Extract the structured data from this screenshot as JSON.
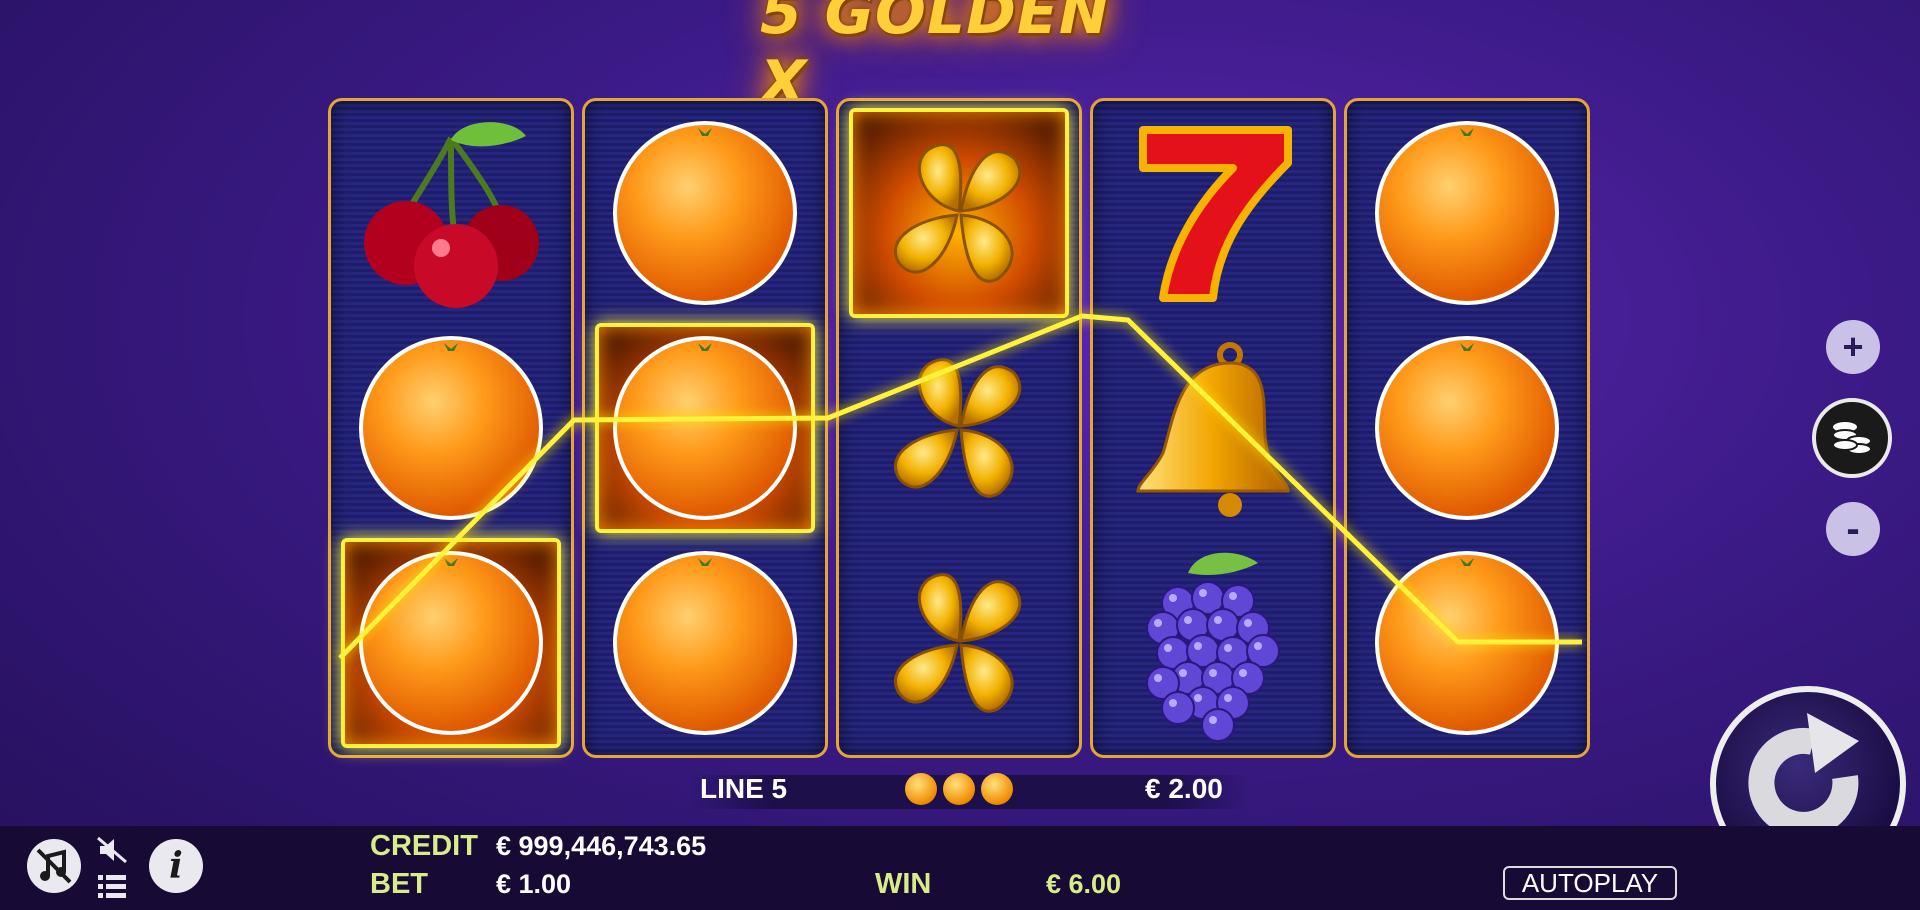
{
  "game": {
    "title": "5 GOLDEN X"
  },
  "reels": [
    {
      "symbols": [
        "cherry-icon",
        "orange-icon",
        "orange-icon"
      ],
      "highlighted": [
        false,
        false,
        true
      ]
    },
    {
      "symbols": [
        "orange-icon",
        "orange-icon",
        "orange-icon"
      ],
      "highlighted": [
        false,
        true,
        false
      ]
    },
    {
      "symbols": [
        "clover-icon",
        "clover-icon",
        "clover-icon"
      ],
      "highlighted": [
        true,
        false,
        false
      ]
    },
    {
      "symbols": [
        "seven-icon",
        "bell-icon",
        "grapes-icon"
      ],
      "highlighted": [
        false,
        false,
        false
      ]
    },
    {
      "symbols": [
        "orange-icon",
        "orange-icon",
        "orange-icon"
      ],
      "highlighted": [
        false,
        false,
        false
      ]
    }
  ],
  "win_line": {
    "label": "LINE 5",
    "coins": 3,
    "amount": "€ 2.00"
  },
  "hud": {
    "credit_label": "CREDIT",
    "credit_value": "€ 999,446,743.65",
    "bet_label": "BET",
    "bet_value": "€ 1.00",
    "win_label": "WIN",
    "win_value": "€ 6.00",
    "autoplay_label": "AUTOPLAY"
  },
  "side_controls": {
    "plus": "+",
    "minus": "-"
  },
  "colors": {
    "win_line": "#fff23a",
    "reel_border": "#e3a43a",
    "label_green": "#d8ec8a"
  }
}
